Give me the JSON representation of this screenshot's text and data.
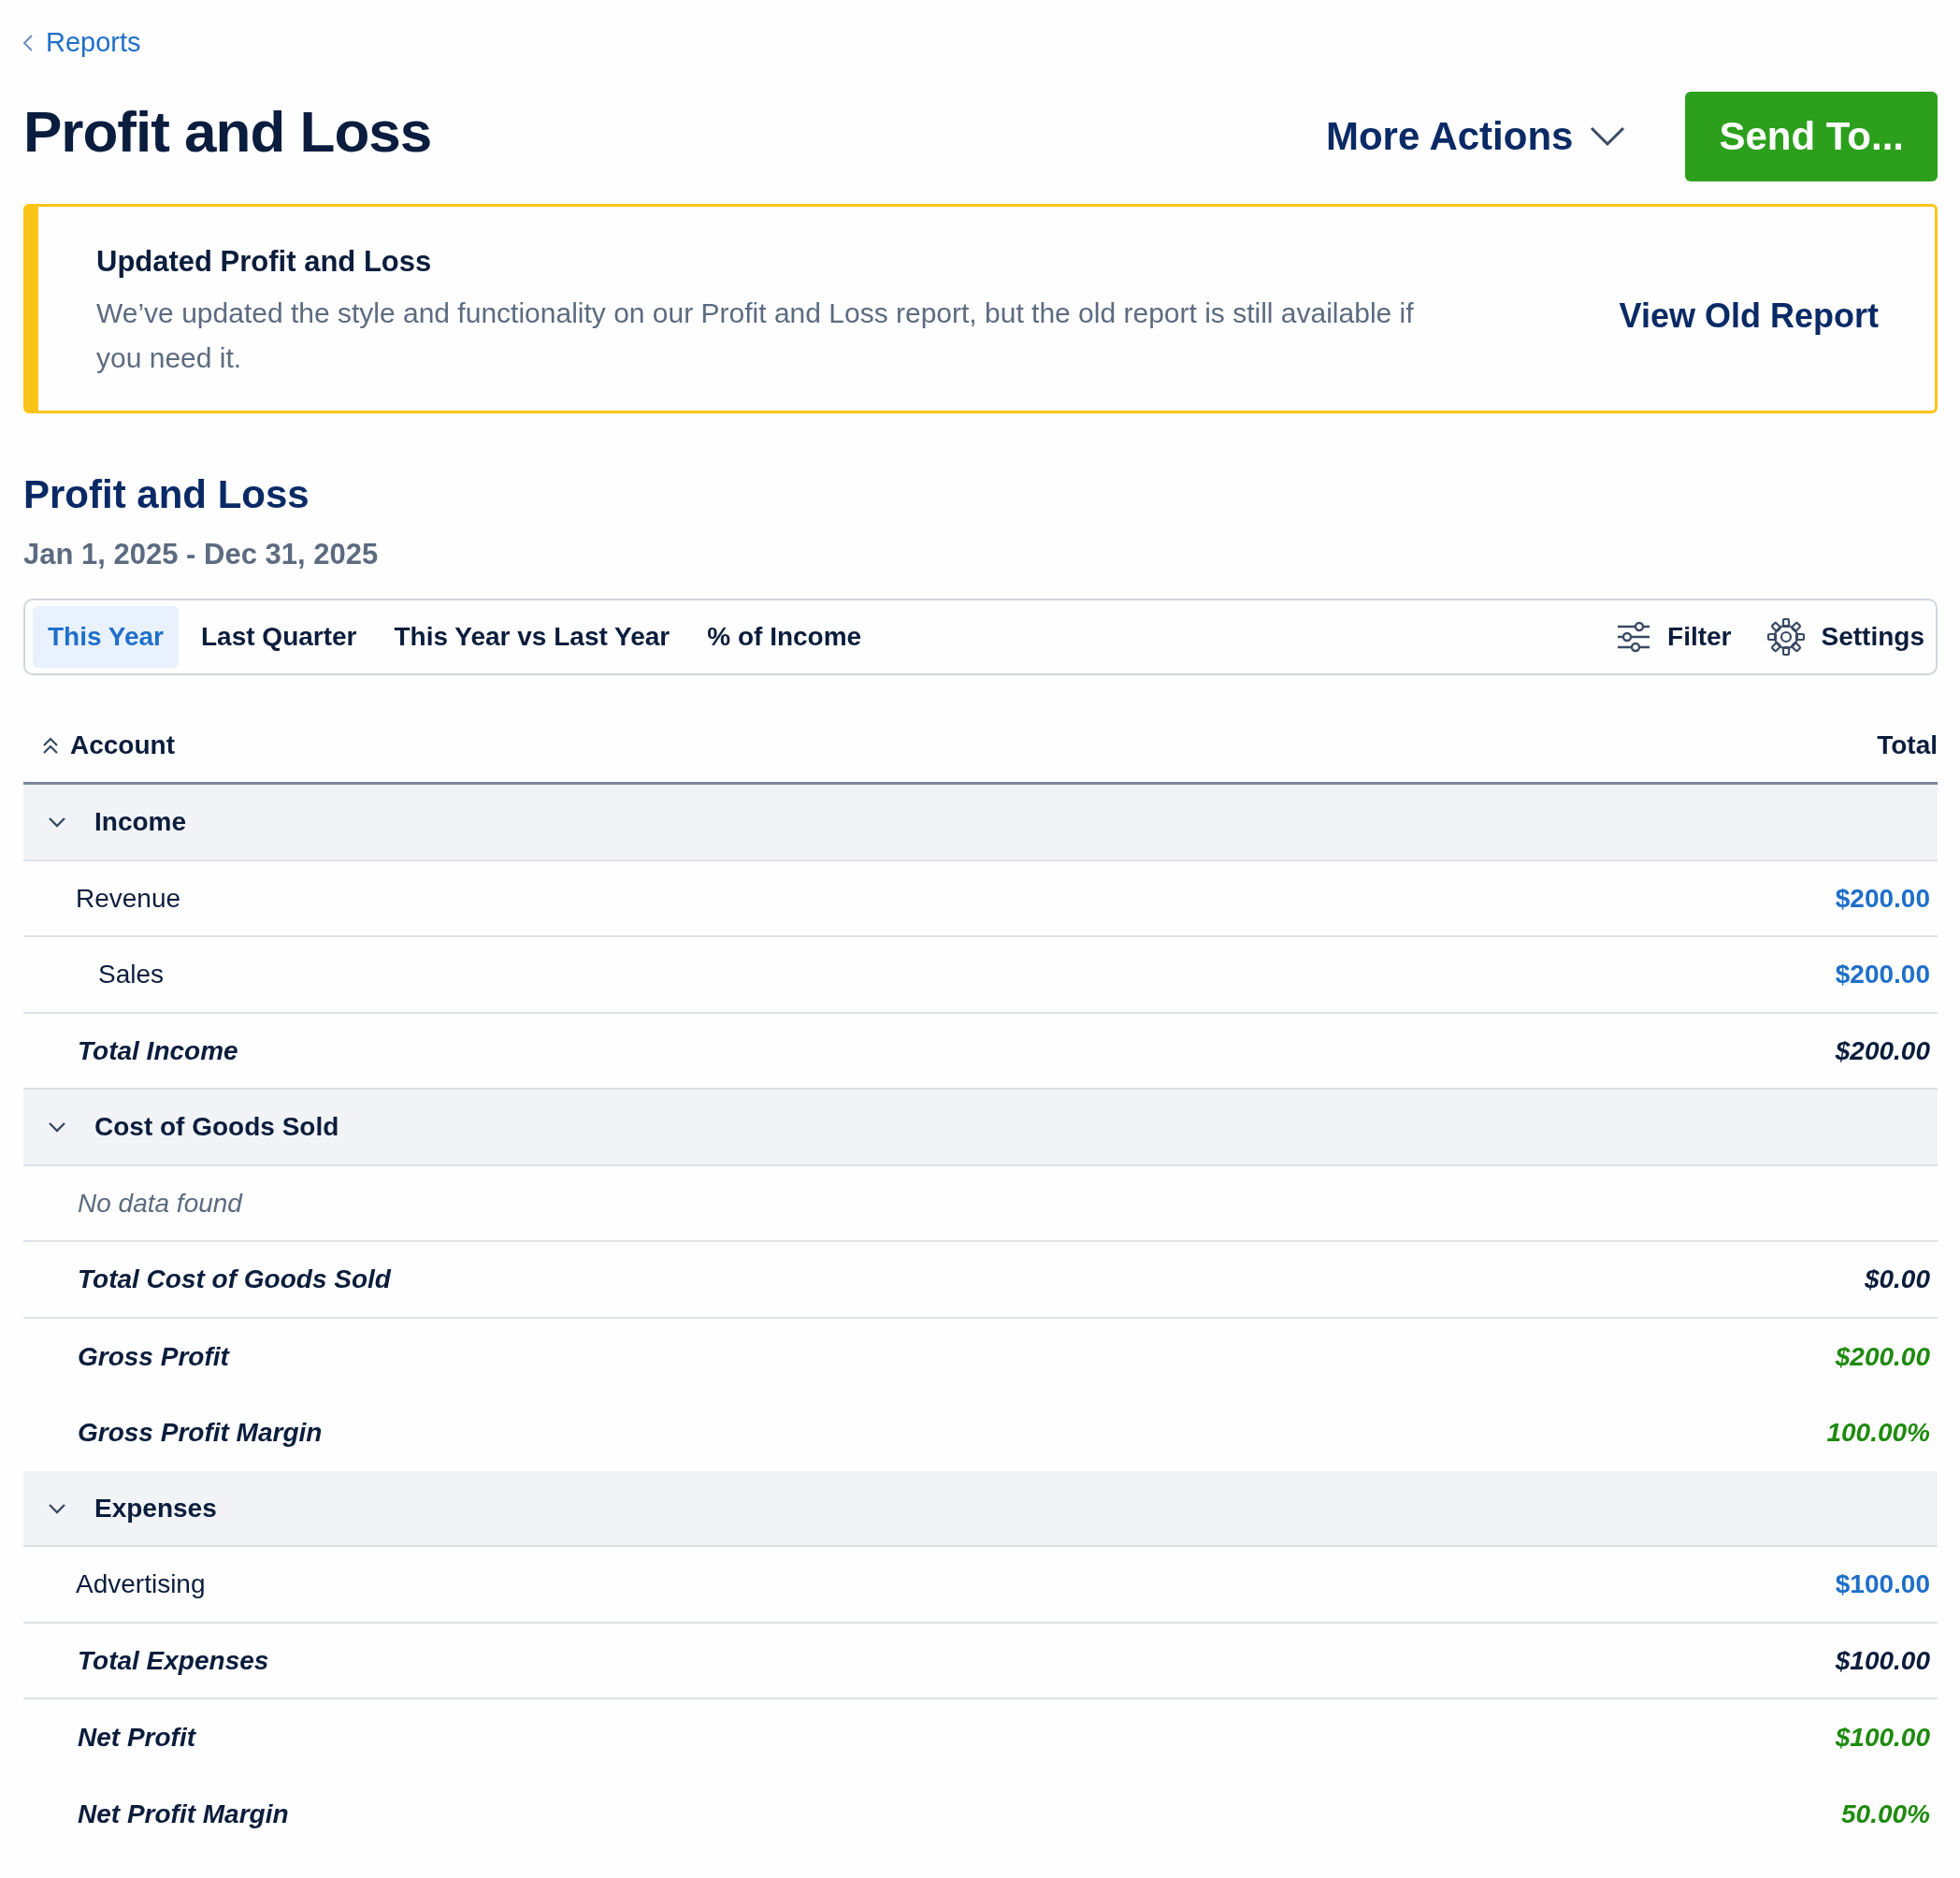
{
  "back_link": "Reports",
  "title": "Profit and Loss",
  "more_actions": "More Actions",
  "send_button": "Send To...",
  "notice": {
    "title": "Updated Profit and Loss",
    "message": "We’ve updated the style and functionality on our Profit and Loss report, but the old report is still available if you need it.",
    "action": "View Old Report"
  },
  "report": {
    "title": "Profit and Loss",
    "date_range": "Jan 1, 2025 - Dec 31, 2025",
    "tabs": [
      {
        "label": "This Year",
        "selected": true
      },
      {
        "label": "Last Quarter",
        "selected": false
      },
      {
        "label": "This Year vs Last Year",
        "selected": false
      },
      {
        "label": "% of Income",
        "selected": false
      }
    ],
    "filter": "Filter",
    "settings": "Settings",
    "columns": [
      "Account",
      "Total"
    ],
    "rows": [
      {
        "kind": "section",
        "label": "Income",
        "expanded": true,
        "children": [
          {
            "kind": "account",
            "label": "Revenue",
            "amount": "$200.00",
            "children": [
              {
                "kind": "account",
                "label": "Sales",
                "amount": "$200.00"
              }
            ]
          }
        ]
      },
      {
        "kind": "total",
        "label": "Total Income",
        "amount": "$200.00"
      },
      {
        "kind": "section",
        "label": "Cost of Goods Sold",
        "expanded": true,
        "children": [
          {
            "kind": "empty",
            "label": "No data found"
          }
        ]
      },
      {
        "kind": "total",
        "label": "Total Cost of Goods Sold",
        "amount": "$0.00"
      },
      {
        "kind": "summary",
        "label": "Gross Profit",
        "amount": "$200.00"
      },
      {
        "kind": "summary",
        "label": "Gross Profit Margin",
        "amount": "100.00%"
      },
      {
        "kind": "section",
        "label": "Expenses",
        "expanded": true,
        "children": [
          {
            "kind": "account",
            "label": "Advertising",
            "amount": "$100.00"
          }
        ]
      },
      {
        "kind": "total",
        "label": "Total Expenses",
        "amount": "$100.00"
      },
      {
        "kind": "summary",
        "label": "Net Profit",
        "amount": "$100.00"
      },
      {
        "kind": "summary",
        "label": "Net Profit Margin",
        "amount": "50.00%"
      }
    ]
  }
}
